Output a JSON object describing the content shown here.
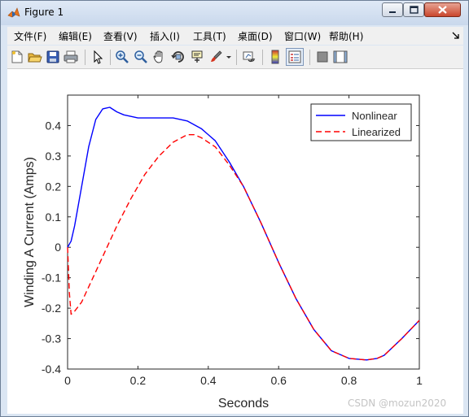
{
  "window": {
    "title": "Figure 1"
  },
  "menu": [
    "文件(F)",
    "编辑(E)",
    "查看(V)",
    "插入(I)",
    "工具(T)",
    "桌面(D)",
    "窗口(W)",
    "帮助(H)"
  ],
  "toolbar": [
    "new-figure-icon",
    "open-file-icon",
    "save-icon",
    "print-icon",
    "pointer-icon",
    "zoom-in-icon",
    "zoom-out-icon",
    "pan-hand-icon",
    "rotate-3d-icon",
    "data-cursor-icon",
    "brush-icon",
    "brush-dropdown-icon",
    "link-plot-icon",
    "colorbar-icon",
    "legend-icon",
    "hide-plot-tools-icon",
    "show-plot-tools-icon"
  ],
  "watermark": "CSDN @mozun2020",
  "chart_data": {
    "type": "line",
    "xlabel": "Seconds",
    "ylabel": "Winding A Current (Amps)",
    "xlim": [
      0,
      1
    ],
    "ylim": [
      -0.4,
      0.5
    ],
    "xticks": [
      "0",
      "0.2",
      "0.4",
      "0.6",
      "0.8",
      "1"
    ],
    "xtick_values": [
      0,
      0.2,
      0.4,
      0.6,
      0.8,
      1
    ],
    "yticks": [
      "-0.4",
      "-0.3",
      "-0.2",
      "-0.1",
      "0",
      "0.1",
      "0.2",
      "0.3",
      "0.4"
    ],
    "ytick_values": [
      -0.4,
      -0.3,
      -0.2,
      -0.1,
      0,
      0.1,
      0.2,
      0.3,
      0.4
    ],
    "grid": false,
    "legend_position": "top-right",
    "series": [
      {
        "name": "Nonlinear",
        "color": "#0000ff",
        "style": "solid",
        "x": [
          0,
          0.01,
          0.02,
          0.04,
          0.06,
          0.08,
          0.1,
          0.12,
          0.14,
          0.16,
          0.18,
          0.2,
          0.24,
          0.3,
          0.34,
          0.38,
          0.42,
          0.46,
          0.5,
          0.55,
          0.6,
          0.65,
          0.7,
          0.75,
          0.8,
          0.85,
          0.88,
          0.9,
          0.95,
          1.0
        ],
        "y": [
          0,
          0.02,
          0.07,
          0.2,
          0.33,
          0.42,
          0.455,
          0.46,
          0.445,
          0.435,
          0.43,
          0.425,
          0.425,
          0.425,
          0.415,
          0.39,
          0.35,
          0.28,
          0.2,
          0.08,
          -0.05,
          -0.17,
          -0.27,
          -0.34,
          -0.365,
          -0.37,
          -0.365,
          -0.355,
          -0.3,
          -0.24
        ]
      },
      {
        "name": "Linearized",
        "color": "#ff0000",
        "style": "dashed",
        "x": [
          0,
          0.005,
          0.01,
          0.02,
          0.04,
          0.06,
          0.08,
          0.1,
          0.14,
          0.18,
          0.22,
          0.26,
          0.3,
          0.34,
          0.36,
          0.38,
          0.42,
          0.46,
          0.5,
          0.55,
          0.6,
          0.65,
          0.7,
          0.75,
          0.8,
          0.85,
          0.88,
          0.9,
          0.95,
          1.0
        ],
        "y": [
          0,
          -0.15,
          -0.22,
          -0.21,
          -0.18,
          -0.13,
          -0.08,
          -0.03,
          0.07,
          0.16,
          0.24,
          0.3,
          0.345,
          0.37,
          0.37,
          0.36,
          0.33,
          0.27,
          0.2,
          0.08,
          -0.05,
          -0.17,
          -0.27,
          -0.34,
          -0.365,
          -0.37,
          -0.365,
          -0.355,
          -0.3,
          -0.24
        ]
      }
    ]
  }
}
